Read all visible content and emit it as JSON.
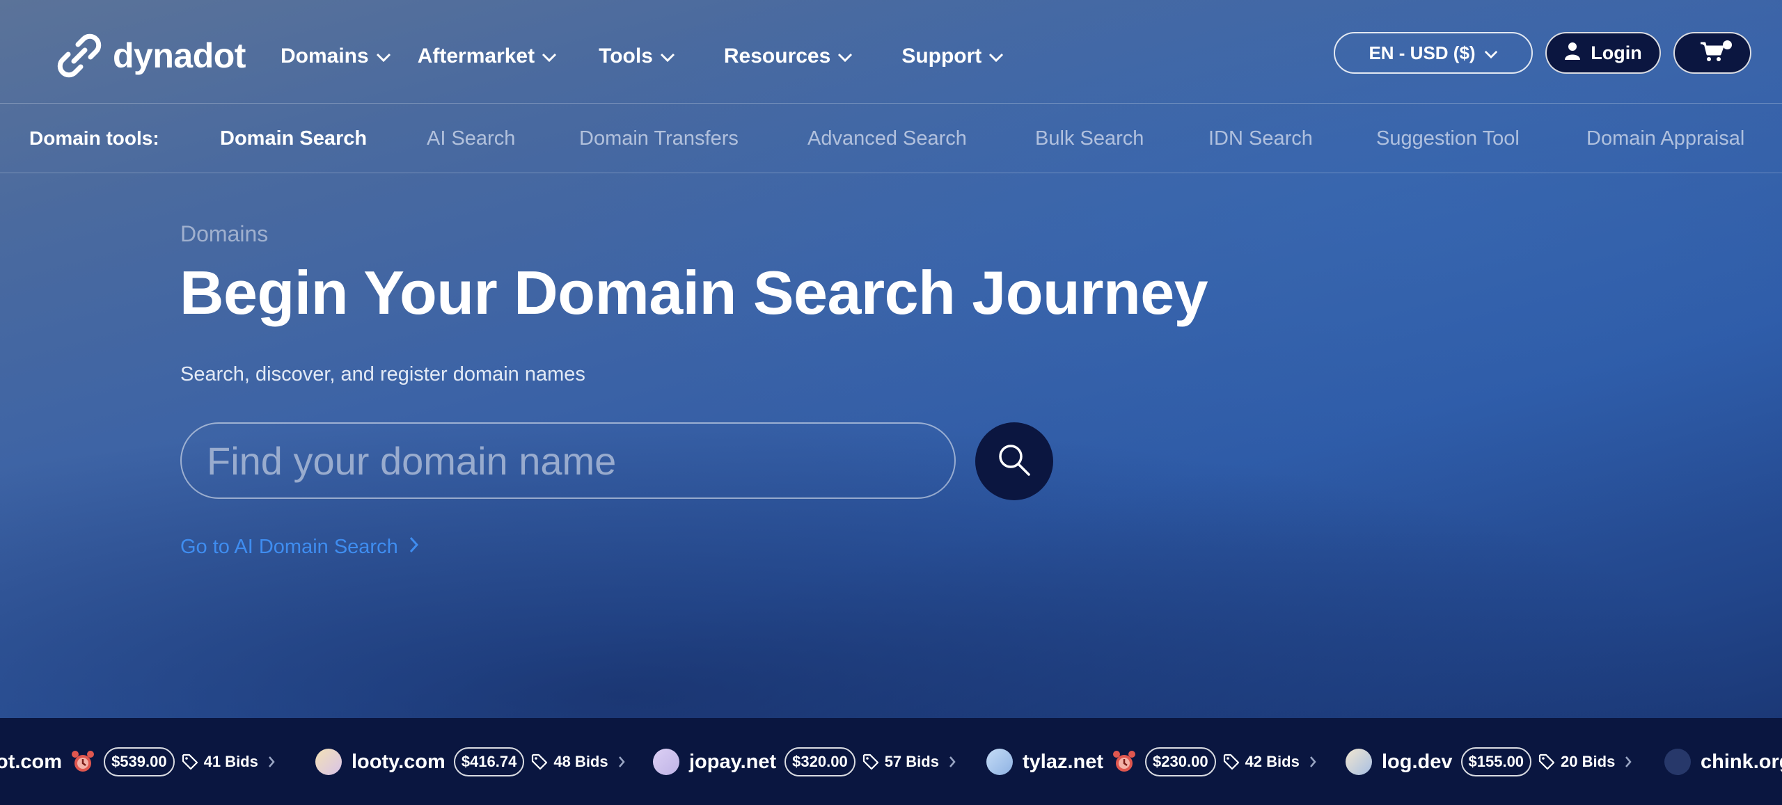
{
  "header": {
    "brand": "dynadot",
    "nav": [
      {
        "label": "Domains"
      },
      {
        "label": "Aftermarket"
      },
      {
        "label": "Tools"
      },
      {
        "label": "Resources"
      },
      {
        "label": "Support"
      }
    ],
    "lang_currency": "EN - USD ($)",
    "login_label": "Login"
  },
  "subnav": {
    "label": "Domain tools:",
    "items": [
      {
        "label": "Domain Search",
        "active": true
      },
      {
        "label": "AI Search"
      },
      {
        "label": "Domain Transfers"
      },
      {
        "label": "Advanced Search"
      },
      {
        "label": "Bulk Search"
      },
      {
        "label": "IDN Search"
      },
      {
        "label": "Suggestion Tool"
      },
      {
        "label": "Domain Appraisal"
      }
    ]
  },
  "hero": {
    "breadcrumb": "Domains",
    "title": "Begin Your Domain Search Journey",
    "subtitle": "Search, discover, and register domain names",
    "search_placeholder": "Find your domain name",
    "ai_link": "Go to AI Domain Search"
  },
  "ticker": {
    "items": [
      {
        "name": "ot.com",
        "price": "$539.00",
        "bids": "41 Bids",
        "alarm": true,
        "avatar_color": ""
      },
      {
        "name": "looty.com",
        "price": "$416.74",
        "bids": "48 Bids",
        "alarm": false,
        "avatar_color": "#e9d4a8"
      },
      {
        "name": "jopay.net",
        "price": "$320.00",
        "bids": "57 Bids",
        "alarm": false,
        "avatar_color": "#cfc3ef"
      },
      {
        "name": "tylaz.net",
        "price": "$230.00",
        "bids": "42 Bids",
        "alarm": true,
        "avatar_color": "#a9c8ef"
      },
      {
        "name": "log.dev",
        "price": "$155.00",
        "bids": "20 Bids",
        "alarm": false,
        "avatar_color": "#d7d2e6"
      },
      {
        "name": "chink.org",
        "price": "",
        "bids": "",
        "alarm": false,
        "avatar_color": "#27386a"
      }
    ]
  },
  "colors": {
    "navy": "#0b1640",
    "link_blue": "#3f8df0",
    "alarm_red": "#e0574f"
  },
  "icons": [
    "dynadot-logo-icon",
    "chevron-down-icon",
    "user-icon",
    "cart-icon",
    "search-icon",
    "chevron-right-icon",
    "alarm-clock-icon",
    "tag-icon"
  ]
}
